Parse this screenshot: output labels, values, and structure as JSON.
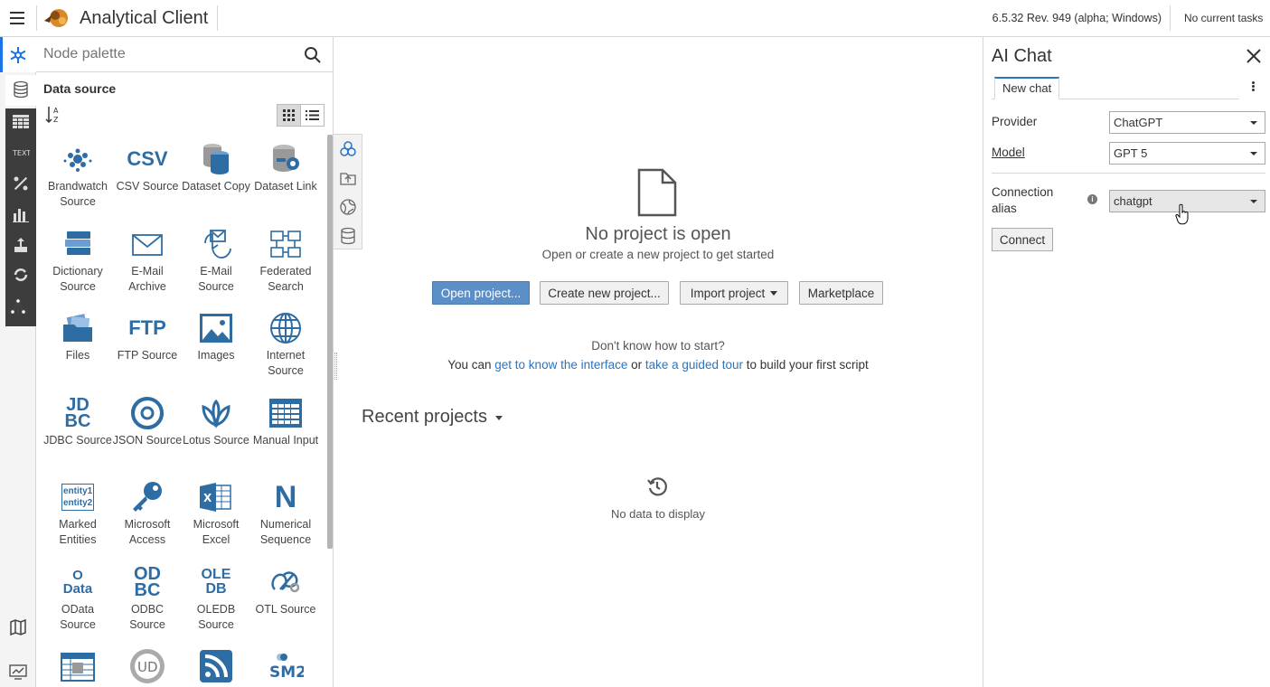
{
  "header": {
    "app_title": "Analytical Client",
    "version": "6.5.32 Rev. 949 (alpha; Windows)",
    "tasks": "No current tasks"
  },
  "palette": {
    "search_placeholder": "Node palette",
    "category": "Data source",
    "nodes": [
      {
        "label": "Brandwatch Source",
        "icon": "brandwatch-icon"
      },
      {
        "label": "CSV Source",
        "icon": "csv-icon",
        "icon_text": "CSV"
      },
      {
        "label": "Dataset Copy",
        "icon": "dataset-copy-icon"
      },
      {
        "label": "Dataset Link",
        "icon": "dataset-link-icon"
      },
      {
        "label": "Dictionary Source",
        "icon": "dictionary-icon"
      },
      {
        "label": "E-Mail Archive",
        "icon": "email-archive-icon"
      },
      {
        "label": "E-Mail Source",
        "icon": "email-source-icon"
      },
      {
        "label": "Federated Search",
        "icon": "federated-search-icon"
      },
      {
        "label": "Files",
        "icon": "files-icon"
      },
      {
        "label": "FTP Source",
        "icon": "ftp-icon",
        "icon_text": "FTP"
      },
      {
        "label": "Images",
        "icon": "images-icon"
      },
      {
        "label": "Internet Source",
        "icon": "internet-icon"
      },
      {
        "label": "JDBC Source",
        "icon": "jdbc-icon",
        "icon_text": "JD BC"
      },
      {
        "label": "JSON Source",
        "icon": "json-icon"
      },
      {
        "label": "Lotus Source",
        "icon": "lotus-icon"
      },
      {
        "label": "Manual Input",
        "icon": "manual-input-icon"
      },
      {
        "label": "Marked Entities",
        "icon": "marked-entities-icon",
        "icon_text": "entity1 entity2"
      },
      {
        "label": "Microsoft Access",
        "icon": "access-key-icon"
      },
      {
        "label": "Microsoft Excel",
        "icon": "excel-icon"
      },
      {
        "label": "Numerical Sequence",
        "icon": "numerical-icon",
        "icon_text": "N"
      },
      {
        "label": "OData Source",
        "icon": "odata-icon",
        "icon_text": "O Data"
      },
      {
        "label": "ODBC Source",
        "icon": "odbc-icon",
        "icon_text": "ODBC"
      },
      {
        "label": "OLEDB Source",
        "icon": "oledb-icon",
        "icon_text": "OLE DB"
      },
      {
        "label": "OTL Source",
        "icon": "otl-icon"
      }
    ]
  },
  "main": {
    "no_project": "No project is open",
    "no_project_sub": "Open or create a new project to get started",
    "btn_open": "Open project...",
    "btn_create": "Create new project...",
    "btn_import": "Import project",
    "btn_market": "Marketplace",
    "dont_know": "Don't know how to start?",
    "help_prefix": "You can ",
    "help_link1": "get to know the interface",
    "help_mid": " or ",
    "help_link2": "take a guided tour",
    "help_suffix": " to build your first script",
    "recent_title": "Recent projects",
    "no_data": "No data to display"
  },
  "chat": {
    "title": "AI Chat",
    "tab": "New chat",
    "provider_label": "Provider",
    "provider_value": "ChatGPT",
    "model_label": "Model",
    "model_value": "GPT 5",
    "alias_label_1": "Connection",
    "alias_label_2": "alias",
    "alias_value": "chatgpt",
    "connect": "Connect"
  },
  "colors": {
    "accent": "#2a75c0",
    "icon_blue": "#2e6da4",
    "primary_button": "#5b8fc7"
  }
}
